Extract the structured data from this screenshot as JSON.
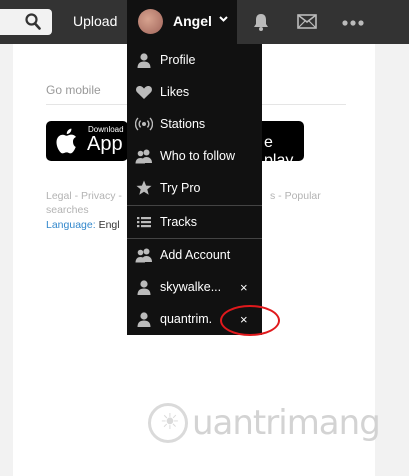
{
  "topbar": {
    "upload_label": "Upload",
    "username": "Angel"
  },
  "menu": {
    "items": [
      {
        "label": "Profile",
        "icon": "person-icon"
      },
      {
        "label": "Likes",
        "icon": "heart-icon"
      },
      {
        "label": "Stations",
        "icon": "radio-waves-icon"
      },
      {
        "label": "Who to follow",
        "icon": "people-icon"
      },
      {
        "label": "Try Pro",
        "icon": "star-icon"
      },
      {
        "label": "Tracks",
        "icon": "list-icon"
      },
      {
        "label": "Add Account",
        "icon": "people-icon"
      },
      {
        "label": "skywalke...",
        "icon": "person-icon",
        "remove": "×"
      },
      {
        "label": "quantrim.",
        "icon": "person-icon",
        "remove": "×"
      }
    ]
  },
  "content": {
    "go_mobile": "Go mobile",
    "app_store_small": "Download",
    "app_store_big": "App S",
    "google_play_tail": "e play",
    "footer_line1_start": "Legal - Privacy -",
    "footer_line1_end": "s - Popular",
    "footer_line2": "searches",
    "language_label": "Language:",
    "language_value": "Engl"
  },
  "watermark": {
    "text": "uantrimang"
  },
  "colors": {
    "topbar": "#333333",
    "menu_bg": "#111111",
    "link": "#3388cc",
    "highlight": "#e0191c"
  }
}
